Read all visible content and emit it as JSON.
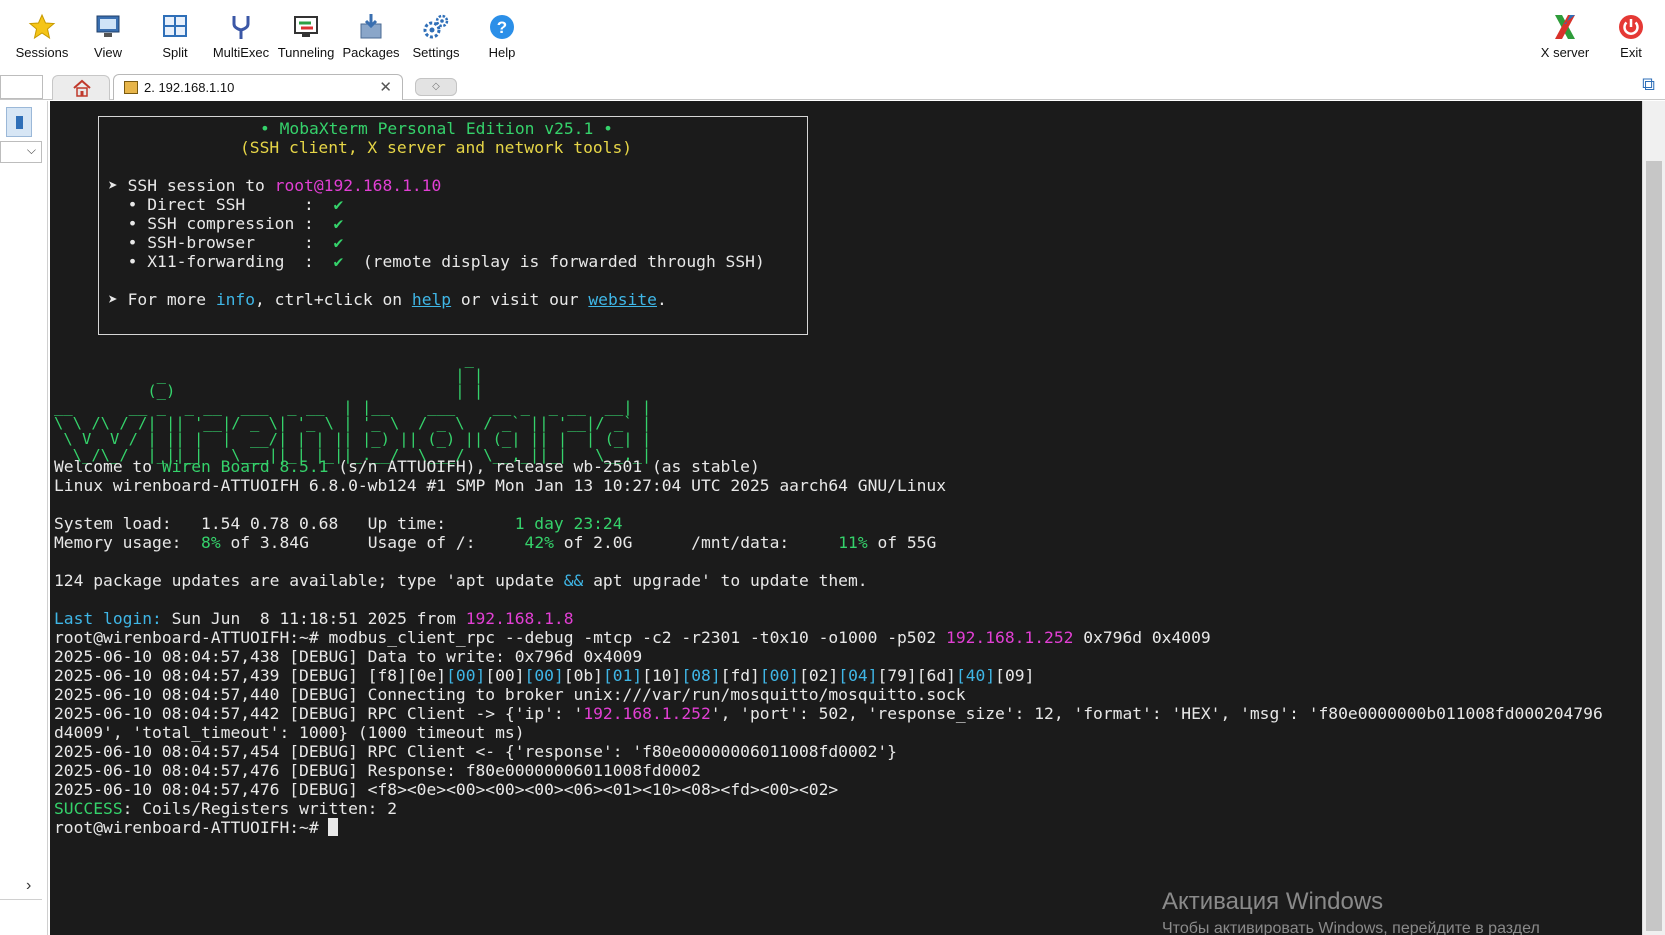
{
  "toolbar": {
    "items": [
      {
        "label": "Sessions",
        "icon": "star-icon"
      },
      {
        "label": "View",
        "icon": "monitor-icon"
      },
      {
        "label": "Split",
        "icon": "split-icon"
      },
      {
        "label": "MultiExec",
        "icon": "fork-icon"
      },
      {
        "label": "Tunneling",
        "icon": "tunnel-icon"
      },
      {
        "label": "Packages",
        "icon": "package-icon"
      },
      {
        "label": "Settings",
        "icon": "gears-icon"
      },
      {
        "label": "Help",
        "icon": "help-icon"
      }
    ],
    "right": [
      {
        "label": "X server",
        "icon": "x-server-icon"
      },
      {
        "label": "Exit",
        "icon": "power-icon"
      }
    ]
  },
  "tabs": {
    "session_title": "2. 192.168.1.10",
    "close_glyph": "✕"
  },
  "banner": {
    "title": "• MobaXterm Personal Edition v25.1 •",
    "subtitle": "(SSH client, X server and network tools)",
    "session_prefix": "➤ SSH session to ",
    "session_host": "root@192.168.1.10",
    "features": [
      {
        "text": "  • Direct SSH      :  ",
        "check": "✔",
        "note": ""
      },
      {
        "text": "  • SSH compression :  ",
        "check": "✔",
        "note": ""
      },
      {
        "text": "  • SSH-browser     :  ",
        "check": "✔",
        "note": ""
      },
      {
        "text": "  • X11-forwarding  :  ",
        "check": "✔",
        "note": "  (remote display is forwarded through SSH)"
      }
    ],
    "more_prefix": "➤ For more ",
    "more_info": "info",
    "more_mid": ", ctrl+click on ",
    "more_help": "help",
    "more_mid2": " or visit our ",
    "more_website": "website",
    "more_end": "."
  },
  "ascii_logo": [
    "                                            _",
    "           _                               | |",
    "          (_)                              | |",
    "__      __ _  _ __  ___  _ __  | |__    ___    __ _  _ __  __| |",
    "\\ \\ /\\ / /| || '__|/ _ \\| '_ \\ | '_ \\  / _ \\  / _` || '__|/ _` |",
    " \\ V  V / | || |  |  __/| | | || |_) || (_) || (_| || |  | (_| |",
    "  \\_/\\_/  |_||_|   \\___||_| |_||_.__/  \\___/  \\__,_||_|   \\__,_|"
  ],
  "motd": {
    "welcome_prefix": "Welcome to ",
    "welcome_product": "Wiren Board 8.5.1",
    "welcome_suffix": " (s/n ATTUOIFH), release wb-2501 (as stable)",
    "kernel": "Linux wirenboard-ATTUOIFH 6.8.0-wb124 #1 SMP Mon Jan 13 10:27:04 UTC 2025 aarch64 GNU/Linux",
    "sysload_label": "System load:   1.54 0.78 0.68   Up time:       ",
    "uptime": "1 day 23:24",
    "mem_label": "Memory usage:  ",
    "mem_pct": "8%",
    "mem_rest": " of 3.84G      Usage of /:     ",
    "root_pct": "42%",
    "root_rest": " of 2.0G      /mnt/data:     ",
    "data_pct": "11%",
    "data_rest": " of 55G",
    "updates_a": "124 package updates are available; type 'apt update ",
    "updates_amp": "&&",
    "updates_b": " apt upgrade' to update them."
  },
  "session": {
    "last_login_label": "Last login:",
    "last_login_text": " Sun Jun  8 11:18:51 2025 from ",
    "last_login_ip": "192.168.1.8",
    "prompt": "root@wirenboard-ATTUOIFH:~# ",
    "command": "modbus_client_rpc --debug -mtcp -c2 -r2301 -t0x10 -o1000 -p502 ",
    "command_ip": "192.168.1.252",
    "command_tail": " 0x796d 0x4009",
    "log1": "2025-06-10 08:04:57,438 [DEBUG] Data to write: 0x796d 0x4009",
    "log2_prefix": "2025-06-10 08:04:57,439 [DEBUG] ",
    "log2_bytes": [
      {
        "t": "[f8]",
        "hl": false
      },
      {
        "t": "[0e]",
        "hl": false
      },
      {
        "t": "[00]",
        "hl": true
      },
      {
        "t": "[00]",
        "hl": false
      },
      {
        "t": "[00]",
        "hl": true
      },
      {
        "t": "[0b]",
        "hl": false
      },
      {
        "t": "[01]",
        "hl": true
      },
      {
        "t": "[10]",
        "hl": false
      },
      {
        "t": "[08]",
        "hl": true
      },
      {
        "t": "[fd]",
        "hl": false
      },
      {
        "t": "[00]",
        "hl": true
      },
      {
        "t": "[02]",
        "hl": false
      },
      {
        "t": "[04]",
        "hl": true
      },
      {
        "t": "[79]",
        "hl": false
      },
      {
        "t": "[6d]",
        "hl": false
      },
      {
        "t": "[40]",
        "hl": true
      },
      {
        "t": "[09]",
        "hl": false
      }
    ],
    "log3": "2025-06-10 08:04:57,440 [DEBUG] Connecting to broker unix:///var/run/mosquitto/mosquitto.sock",
    "log4_prefix": "2025-06-10 08:04:57,442 [DEBUG] RPC Client -> {'ip': '",
    "log4_ip": "192.168.1.252",
    "log4_rest": "', 'port': 502, 'response_size': 12, 'format': 'HEX', 'msg': 'f80e0000000b011008fd000204796",
    "log4_wrap": "d4009', 'total_timeout': 1000} (1000 timeout ms)",
    "log5": "2025-06-10 08:04:57,454 [DEBUG] RPC Client <- {'response': 'f80e00000006011008fd0002'}",
    "log6": "2025-06-10 08:04:57,476 [DEBUG] Response: f80e00000006011008fd0002",
    "log7": "2025-06-10 08:04:57,476 [DEBUG] <f8><0e><00><00><00><06><01><10><08><fd><00><02>",
    "success_label": "SUCCESS",
    "success_text": ": Coils/Registers written: 2",
    "final_prompt": "root@wirenboard-ATTUOIFH:~# "
  },
  "watermark": {
    "line1": "Активация Windows",
    "line2": "Чтобы активировать Windows, перейдите в раздел"
  },
  "colors": {
    "terminal_bg": "#1b1b1b",
    "green": "#35d26b",
    "yellow": "#e6d547",
    "magenta": "#e23fd4",
    "cyan": "#3fb6e6"
  }
}
